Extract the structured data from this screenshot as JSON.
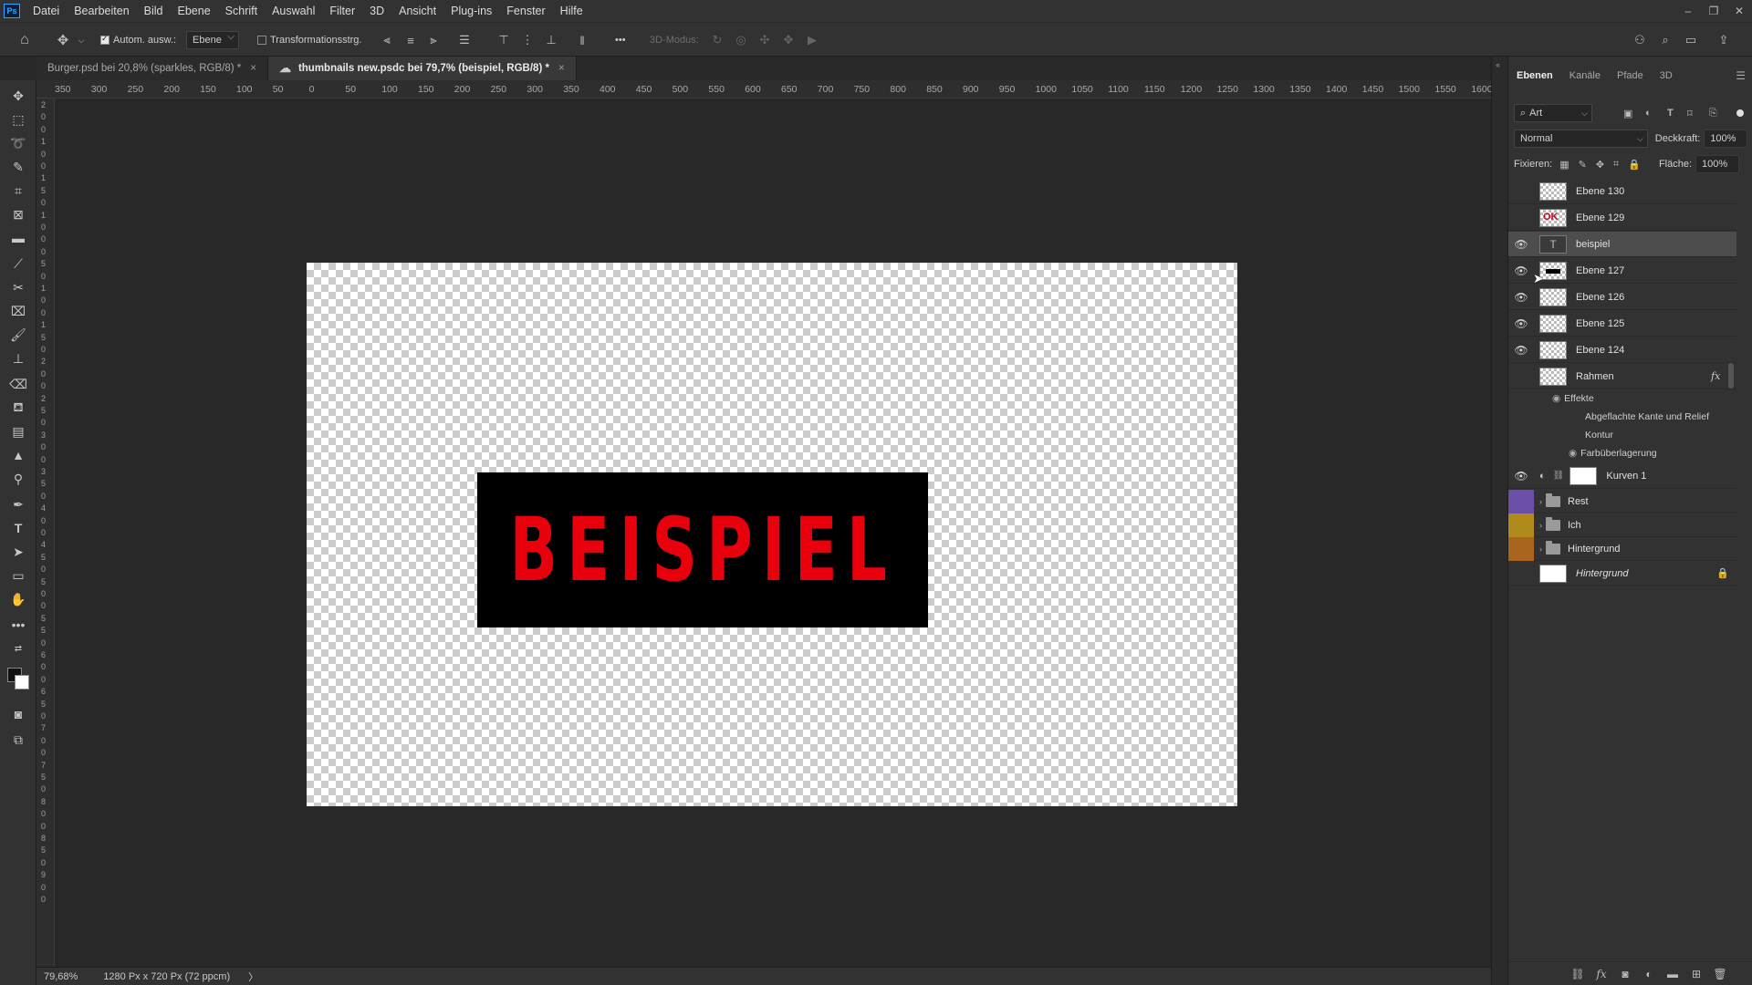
{
  "app": {
    "logo": "Ps"
  },
  "menu": [
    "Datei",
    "Bearbeiten",
    "Bild",
    "Ebene",
    "Schrift",
    "Auswahl",
    "Filter",
    "3D",
    "Ansicht",
    "Plug-ins",
    "Fenster",
    "Hilfe"
  ],
  "options": {
    "auto_select_label": "Autom. ausw.:",
    "auto_select_checked": true,
    "auto_select_target": "Ebene",
    "transform_label": "Transformationsstrg.",
    "transform_checked": false,
    "more": "•••",
    "mode_3d": "3D-Modus:"
  },
  "tabs": [
    {
      "label": "Burger.psd bei 20,8% (sparkles, RGB/8) *",
      "close": "×",
      "active": false
    },
    {
      "label": "thumbnails new.psdc bei 79,7% (beispiel, RGB/8) *",
      "close": "×",
      "active": true
    }
  ],
  "ruler": {
    "top": [
      "350",
      "300",
      "250",
      "200",
      "150",
      "100",
      "50",
      "0",
      "50",
      "100",
      "150",
      "200",
      "250",
      "300",
      "350",
      "400",
      "450",
      "500",
      "550",
      "600",
      "650",
      "700",
      "750",
      "800",
      "850",
      "900",
      "950",
      "1000",
      "1050",
      "1100",
      "1150",
      "1200",
      "1250",
      "1300",
      "1350",
      "1400",
      "1450",
      "1500",
      "1550",
      "1600"
    ],
    "left": [
      "2",
      "0",
      "0",
      "1",
      "0",
      "0",
      "1",
      "5",
      "0",
      "1",
      "0",
      "0",
      "0",
      "5",
      "0",
      "1",
      "0",
      "0",
      "1",
      "5",
      "0",
      "2",
      "0",
      "0",
      "2",
      "5",
      "0",
      "3",
      "0",
      "0",
      "3",
      "5",
      "0",
      "4",
      "0",
      "0",
      "4",
      "5",
      "0",
      "5",
      "0",
      "0",
      "5",
      "5",
      "0",
      "6",
      "0",
      "0",
      "6",
      "5",
      "0",
      "7",
      "0",
      "0",
      "7",
      "5",
      "0",
      "8",
      "0",
      "0",
      "8",
      "5",
      "0",
      "9",
      "0",
      "0"
    ]
  },
  "canvas": {
    "text": "BEISPIEL"
  },
  "status": {
    "zoom": "79,68%",
    "doc_size": "1280 Px x 720 Px (72 ppcm)",
    "arrow": "〉"
  },
  "layers_panel": {
    "tabs": [
      "Ebenen",
      "Kanäle",
      "Pfade",
      "3D"
    ],
    "filter_label": "Art",
    "blend_mode": "Normal",
    "opacity_label": "Deckkraft:",
    "opacity_value": "100%",
    "lock_label": "Fixieren:",
    "fill_label": "Fläche:",
    "fill_value": "100%",
    "layers": [
      {
        "name": "Ebene 130",
        "visible": false,
        "thumb": "transparent"
      },
      {
        "name": "Ebene 129",
        "visible": false,
        "thumb": "red-text"
      },
      {
        "name": "beispiel",
        "visible": true,
        "thumb": "text",
        "thumb_glyph": "T",
        "selected": true
      },
      {
        "name": "Ebene 127",
        "visible": true,
        "thumb": "black-bar"
      },
      {
        "name": "Ebene 126",
        "visible": true,
        "thumb": "transparent"
      },
      {
        "name": "Ebene 125",
        "visible": true,
        "thumb": "transparent"
      },
      {
        "name": "Ebene 124",
        "visible": true,
        "thumb": "transparent"
      },
      {
        "name": "Rahmen",
        "visible": false,
        "thumb": "transparent",
        "fx": "fx"
      }
    ],
    "effects": {
      "header": "Effekte",
      "items": [
        "Abgeflachte Kante und Relief",
        "Kontur",
        "Farbüberlagerung"
      ]
    },
    "adjustment": {
      "name": "Kurven 1",
      "visible": true
    },
    "groups": [
      {
        "name": "Rest",
        "color": "#6b4fa8"
      },
      {
        "name": "Ich",
        "color": "#b08a1a"
      },
      {
        "name": "Hintergrund",
        "color": "#a9651e"
      }
    ],
    "background_layer": {
      "name": "Hintergrund",
      "locked": true
    },
    "bottom_icons": [
      "link-icon",
      "fx-icon",
      "mask-icon",
      "adjustment-icon",
      "group-icon",
      "new-layer-icon",
      "trash-icon"
    ]
  },
  "colors": {
    "accent": "#31a8ff",
    "text_red": "#e8000d",
    "selected_row": "#4d4d4d"
  }
}
